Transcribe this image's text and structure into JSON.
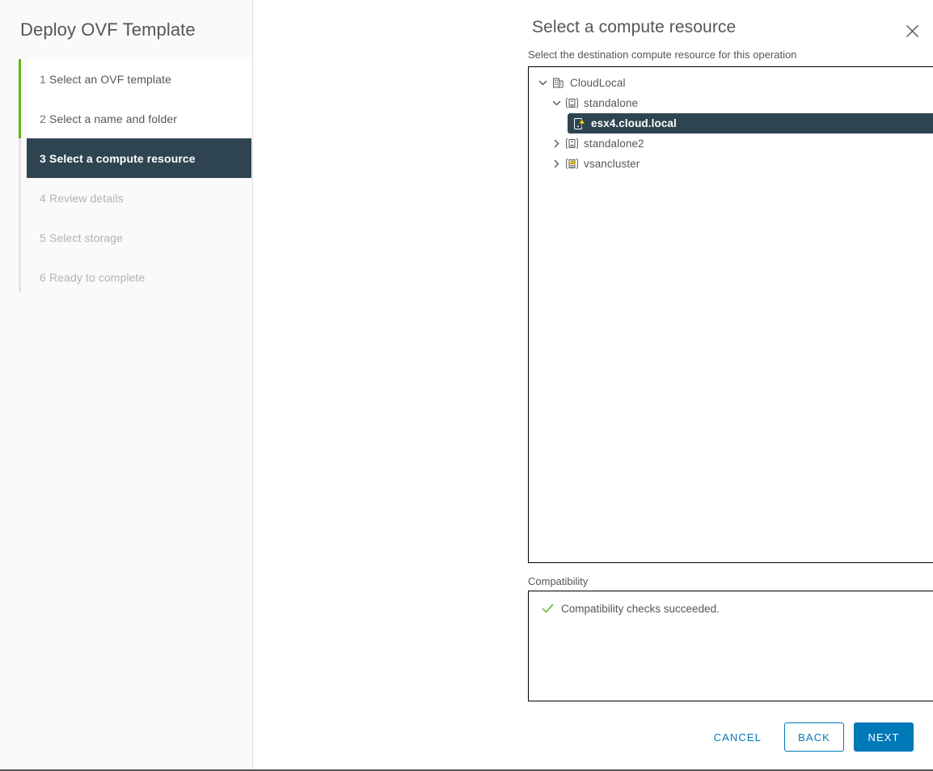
{
  "window": {
    "wizard_title": "Deploy OVF Template",
    "close_icon": "close-icon"
  },
  "sidebar": {
    "steps": [
      {
        "num": "1",
        "label": "Select an OVF template",
        "state": "done"
      },
      {
        "num": "2",
        "label": "Select a name and folder",
        "state": "done"
      },
      {
        "num": "3",
        "label": "Select a compute resource",
        "state": "active"
      },
      {
        "num": "4",
        "label": "Review details",
        "state": "pending"
      },
      {
        "num": "5",
        "label": "Select storage",
        "state": "pending"
      },
      {
        "num": "6",
        "label": "Ready to complete",
        "state": "pending"
      }
    ],
    "rail_color_done": "#60b515",
    "rail_color_pending": "#e4e4e4",
    "active_bg": "#2e4451"
  },
  "main": {
    "title": "Select a compute resource",
    "subtitle": "Select the destination compute resource for this operation"
  },
  "tree": {
    "nodes": [
      {
        "label": "CloudLocal",
        "depth": 0,
        "icon": "datacenter-icon",
        "twisty": "chevron-down-icon",
        "expanded": true,
        "selected": false,
        "warning": false
      },
      {
        "label": "standalone",
        "depth": 1,
        "icon": "cluster-icon",
        "twisty": "chevron-down-icon",
        "expanded": true,
        "selected": false,
        "warning": false
      },
      {
        "label": "esx4.cloud.local",
        "depth": 2,
        "icon": "host-icon",
        "twisty": "none",
        "expanded": false,
        "selected": true,
        "warning": true
      },
      {
        "label": "standalone2",
        "depth": 1,
        "icon": "cluster-icon",
        "twisty": "chevron-right-icon",
        "expanded": false,
        "selected": false,
        "warning": false
      },
      {
        "label": "vsancluster",
        "depth": 1,
        "icon": "cluster-icon",
        "twisty": "chevron-right-icon",
        "expanded": false,
        "selected": false,
        "warning": true
      }
    ]
  },
  "compatibility": {
    "label": "Compatibility",
    "status_icon": "check-icon",
    "status_color": "#60b515",
    "message": "Compatibility checks succeeded."
  },
  "footer": {
    "cancel_label": "CANCEL",
    "back_label": "BACK",
    "next_label": "NEXT",
    "accent_color": "#0079b8"
  }
}
